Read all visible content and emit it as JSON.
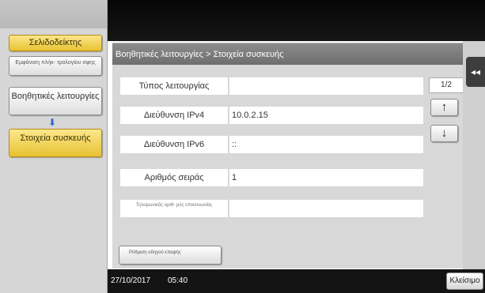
{
  "sidebar": {
    "bookmark_label": "Σελιδοδείκτης",
    "find_label": "Εμφάνιση πλήκ- τρολογίου σφης",
    "utility_label": "Βοηθητικές λειτουργίες",
    "down_arrow": "⬇",
    "device_label": "Στοιχεία συσκευής"
  },
  "header": {
    "breadcrumb": "Βοηθητικές λειτουργίες > Στοιχεία συσκευής"
  },
  "rows": [
    {
      "label": "Τύπος λειτουργίας",
      "value": ""
    },
    {
      "label": "Διεύθυνση IPv4",
      "value": "10.0.2.15"
    },
    {
      "label": "Διεύθυνση IPv6",
      "value": "::"
    },
    {
      "label": "Αριθμός σειράς",
      "value": "1"
    },
    {
      "label": "Τηλεφωνικός αριθ- μός επικοινωνίας",
      "value": ""
    }
  ],
  "pager": {
    "page_text": "1/2",
    "up_symbol": "↑",
    "down_symbol": "↓"
  },
  "bottom_button_label": "Ρύθμιση οδηγού επαφής",
  "back_tab_symbol": "◂◂",
  "status": {
    "date": "27/10/2017",
    "time": "05:40",
    "close_label": "Κλείσιμο"
  },
  "colors": {
    "accent_yellow": "#e9c233",
    "panel_gray": "#d8d8d8",
    "bar_black": "#141414"
  }
}
